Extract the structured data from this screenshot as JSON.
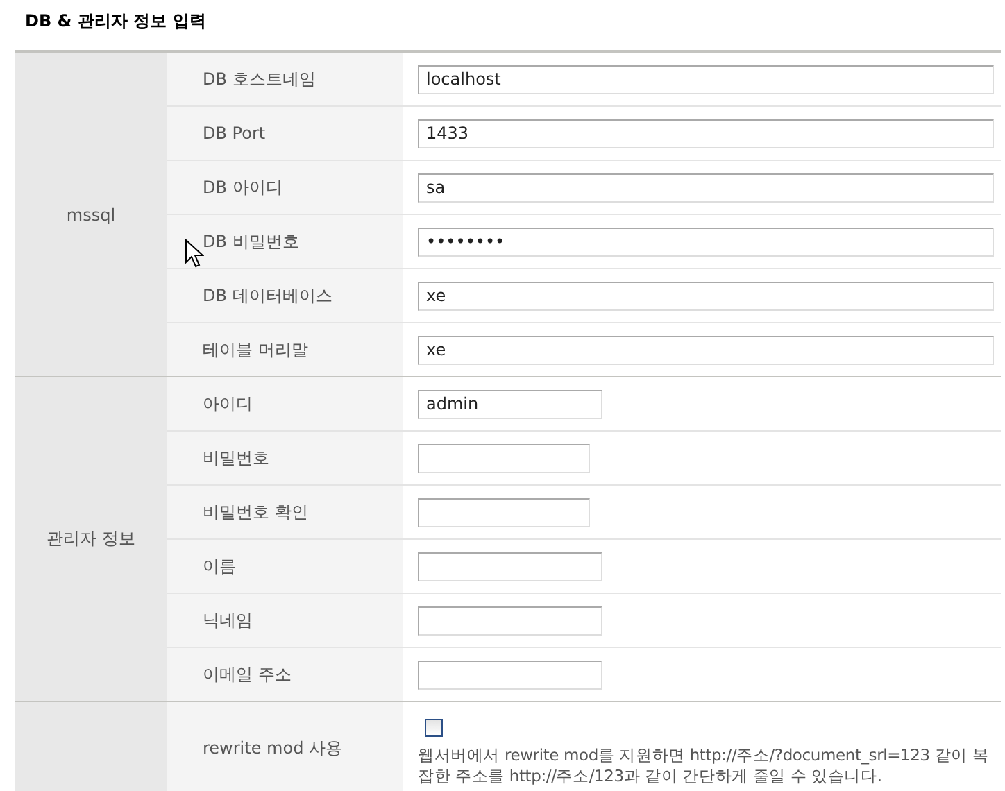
{
  "title": "DB & 관리자 정보 입력",
  "sections": [
    {
      "label": "mssql",
      "rows": [
        {
          "kind": "wide-field",
          "label": "DB 호스트네임",
          "value": "localhost"
        },
        {
          "kind": "wide-field",
          "label": "DB Port",
          "value": "1433"
        },
        {
          "kind": "wide-field",
          "label": "DB 아이디",
          "value": "sa"
        },
        {
          "kind": "wide-field",
          "label": "DB 비밀번호",
          "value": "••••••••"
        },
        {
          "kind": "wide-field",
          "label": "DB 데이터베이스",
          "value": "xe"
        },
        {
          "kind": "wide-field",
          "label": "테이블 머리말",
          "value": "xe"
        }
      ]
    },
    {
      "label": "관리자 정보",
      "rows": [
        {
          "kind": "field",
          "label": "아이디",
          "value": "admin"
        },
        {
          "kind": "short-field",
          "label": "비밀번호"
        },
        {
          "kind": "short-field",
          "label": "비밀번호 확인"
        },
        {
          "kind": "field",
          "label": "이름"
        },
        {
          "kind": "field",
          "label": "닉네임"
        },
        {
          "kind": "field",
          "label": "이메일 주소"
        }
      ]
    },
    {
      "rows": [
        {
          "kind": "checkbox",
          "label": "rewrite mod 사용",
          "checked": false,
          "description": "웹서버에서 rewrite mod를 지원하면 http://주소/?document_srl=123 같이 복잡한 주소를 http://주소/123과 같이 간단하게 줄일 수 있습니다."
        }
      ]
    }
  ]
}
